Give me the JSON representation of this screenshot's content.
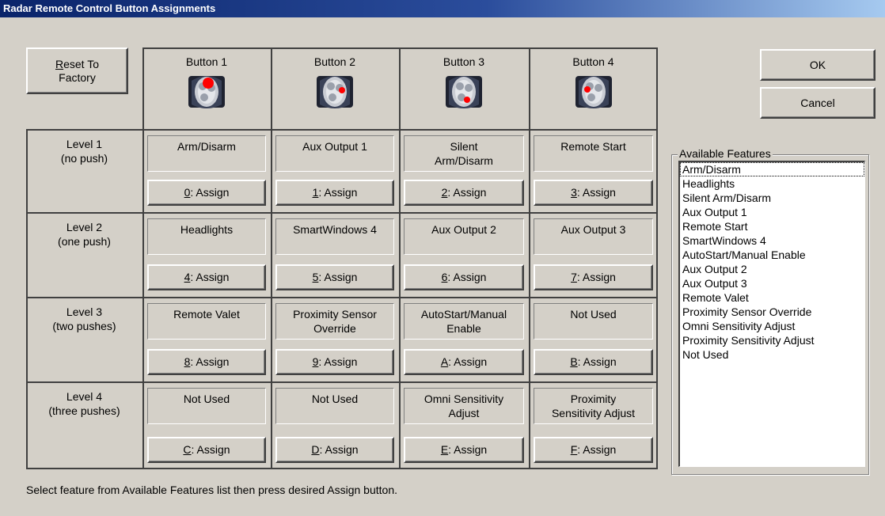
{
  "title": "Radar Remote Control Button Assignments",
  "reset_label": "Reset To Factory",
  "ok_label": "OK",
  "cancel_label": "Cancel",
  "buttons": [
    {
      "label": "Button 1",
      "dot": "large-top"
    },
    {
      "label": "Button 2",
      "dot": "small-right"
    },
    {
      "label": "Button 3",
      "dot": "small-bottom"
    },
    {
      "label": "Button 4",
      "dot": "small-left"
    }
  ],
  "levels": [
    {
      "line1": "Level 1",
      "line2": "(no push)"
    },
    {
      "line1": "Level 2",
      "line2": "(one push)"
    },
    {
      "line1": "Level 3",
      "line2": "(two pushes)"
    },
    {
      "line1": "Level 4",
      "line2": "(three pushes)"
    }
  ],
  "features": [
    [
      {
        "line1": "Arm/Disarm",
        "line2": ""
      },
      {
        "line1": "Aux Output 1",
        "line2": ""
      },
      {
        "line1": "Silent",
        "line2": "Arm/Disarm"
      },
      {
        "line1": "Remote Start",
        "line2": ""
      }
    ],
    [
      {
        "line1": "Headlights",
        "line2": ""
      },
      {
        "line1": "SmartWindows 4",
        "line2": ""
      },
      {
        "line1": "Aux Output 2",
        "line2": ""
      },
      {
        "line1": "Aux Output 3",
        "line2": ""
      }
    ],
    [
      {
        "line1": "Remote Valet",
        "line2": ""
      },
      {
        "line1": "Proximity Sensor",
        "line2": "Override"
      },
      {
        "line1": "AutoStart/Manual",
        "line2": "Enable"
      },
      {
        "line1": "Not Used",
        "line2": ""
      }
    ],
    [
      {
        "line1": "Not Used",
        "line2": ""
      },
      {
        "line1": "Not Used",
        "line2": ""
      },
      {
        "line1": "Omni Sensitivity",
        "line2": "Adjust"
      },
      {
        "line1": "Proximity",
        "line2": "Sensitivity Adjust"
      }
    ]
  ],
  "assign": [
    [
      {
        "key": "0",
        "rest": ": Assign"
      },
      {
        "key": "1",
        "rest": ": Assign"
      },
      {
        "key": "2",
        "rest": ": Assign"
      },
      {
        "key": "3",
        "rest": ": Assign"
      }
    ],
    [
      {
        "key": "4",
        "rest": ": Assign"
      },
      {
        "key": "5",
        "rest": ": Assign"
      },
      {
        "key": "6",
        "rest": ": Assign"
      },
      {
        "key": "7",
        "rest": ": Assign"
      }
    ],
    [
      {
        "key": "8",
        "rest": ": Assign"
      },
      {
        "key": "9",
        "rest": ": Assign"
      },
      {
        "key": "A",
        "rest": ": Assign"
      },
      {
        "key": "B",
        "rest": ": Assign"
      }
    ],
    [
      {
        "key": "C",
        "rest": ": Assign"
      },
      {
        "key": "D",
        "rest": ": Assign"
      },
      {
        "key": "E",
        "rest": ": Assign"
      },
      {
        "key": "F",
        "rest": ": Assign"
      }
    ]
  ],
  "available_features_label": "Available Features",
  "available_features": [
    "Arm/Disarm",
    "Headlights",
    "Silent Arm/Disarm",
    "Aux Output 1",
    "Remote Start",
    "SmartWindows 4",
    "AutoStart/Manual Enable",
    "Aux Output 2",
    "Aux Output 3",
    "Remote Valet",
    "Proximity Sensor Override",
    "Omni Sensitivity Adjust",
    "Proximity Sensitivity Adjust",
    "Not Used"
  ],
  "selected_feature_index": 0,
  "status_text": "Select feature from Available Features list then press desired Assign button.",
  "colors": {
    "title_start": "#0a246a",
    "title_end": "#a6caf0",
    "face": "#d4d0c8",
    "dot": "#ff0000"
  }
}
